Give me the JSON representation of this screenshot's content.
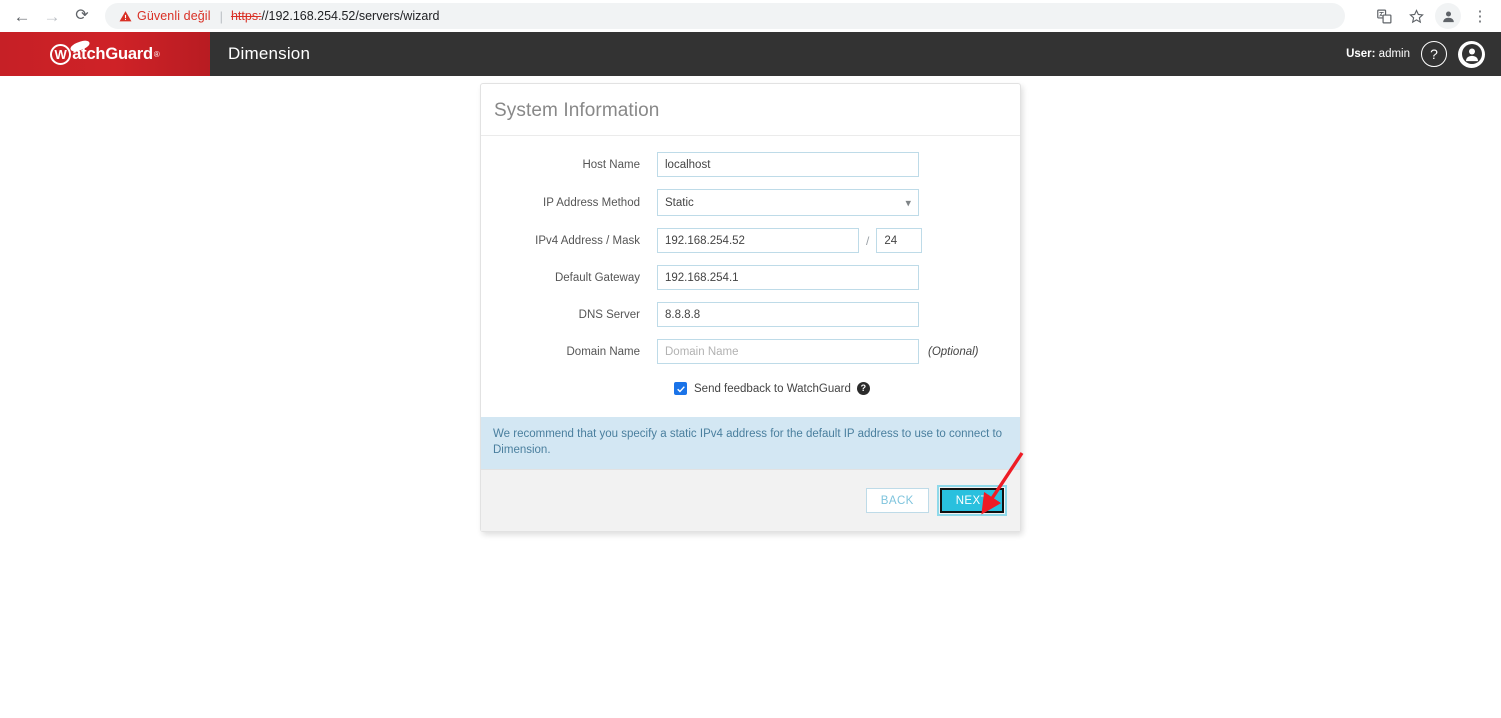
{
  "browser": {
    "back_icon": "back-arrow-icon",
    "forward_icon": "forward-arrow-icon",
    "reload_icon": "reload-icon",
    "security_warning": "Güvenli değil",
    "url_scheme": "https:",
    "url_rest": "//192.168.254.52/servers/wizard",
    "separator": "|",
    "icons": {
      "extension": "translate-icon",
      "bookmark": "star-icon",
      "profile": "profile-avatar-icon",
      "menu": "three-dot-menu-icon"
    }
  },
  "app_header": {
    "logo_initial": "W",
    "logo_text": "atchGuard",
    "logo_tm": "®",
    "title": "Dimension",
    "user_prefix": "User:",
    "user_name": "admin",
    "help_icon_glyph": "?",
    "account_icon": "user-avatar-icon",
    "logo_bg": "#cc2127",
    "bar_bg": "#333333"
  },
  "panel": {
    "title": "System Information",
    "fields": [
      {
        "label": "Host Name",
        "value": "localhost",
        "placeholder": ""
      },
      {
        "label": "IP Address Method",
        "value": "Static",
        "placeholder": ""
      },
      {
        "label": "IPv4 Address / Mask",
        "value": "192.168.254.52",
        "mask": "24",
        "separator": "/"
      },
      {
        "label": "Default Gateway",
        "value": "192.168.254.1",
        "placeholder": ""
      },
      {
        "label": "DNS Server",
        "value": "8.8.8.8",
        "placeholder": ""
      },
      {
        "label": "Domain Name",
        "value": "",
        "placeholder": "Domain Name",
        "suffix": "(Optional)"
      }
    ],
    "checkbox": {
      "label": "Send feedback to WatchGuard",
      "checked": true,
      "help_glyph": "?"
    },
    "info_text": "We recommend that you specify a static IPv4 address for the default IP address to use to connect to Dimension.",
    "info_bg": "#d3e7f3",
    "buttons": {
      "back": "BACK",
      "next": "NEXT"
    },
    "accent_color": "#29c0de",
    "input_border": "#bedbe8"
  },
  "annotation": {
    "type": "red-arrow",
    "color": "#ee1c25",
    "points_to": "NEXT"
  }
}
